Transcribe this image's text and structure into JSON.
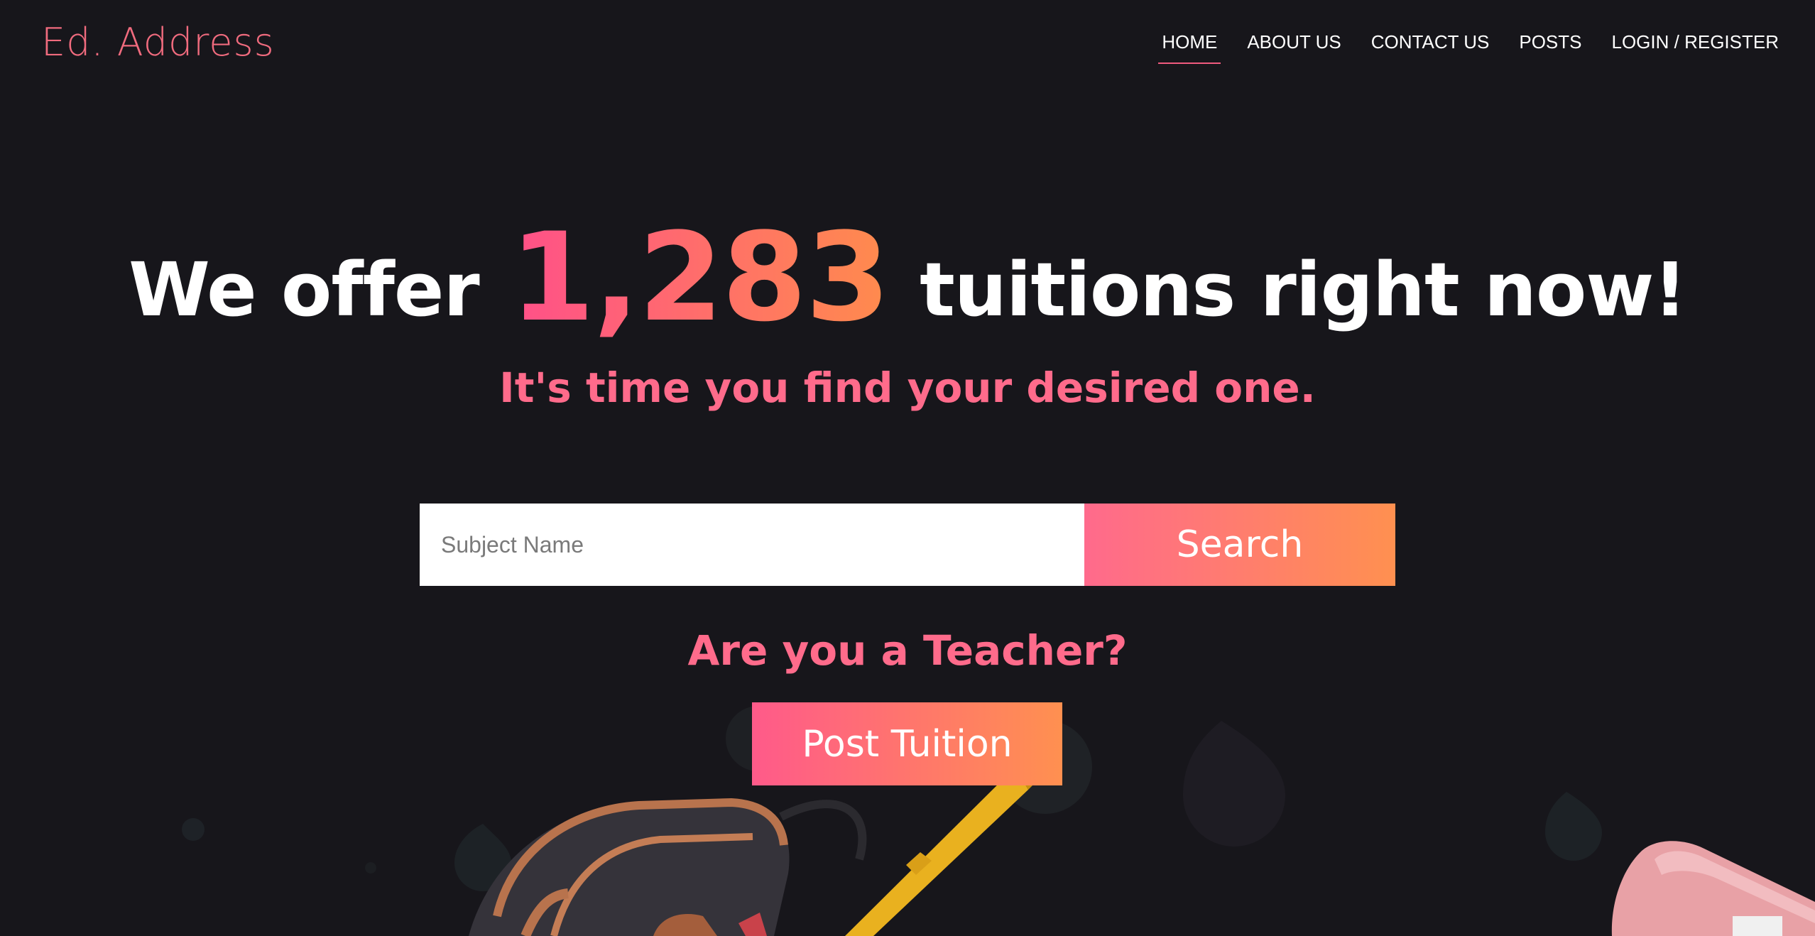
{
  "brand": {
    "logo": "Ed. Address"
  },
  "nav": {
    "items": [
      {
        "label": "HOME",
        "active": true
      },
      {
        "label": "ABOUT US",
        "active": false
      },
      {
        "label": "CONTACT US",
        "active": false
      },
      {
        "label": "POSTS",
        "active": false
      },
      {
        "label": "LOGIN / REGISTER",
        "active": false
      }
    ]
  },
  "hero": {
    "title_prefix": "We offer",
    "count": "1,283",
    "title_suffix": "tuitions right now!",
    "subtitle": "It's time you find your desired one."
  },
  "search": {
    "placeholder": "Subject Name",
    "value": "",
    "button_label": "Search"
  },
  "teacher": {
    "question": "Are you a Teacher?",
    "button_label": "Post Tuition"
  },
  "colors": {
    "background": "#17161b",
    "accent_pink": "#ff6b8b",
    "accent_orange": "#ff9050",
    "logo": "#f06b7e"
  },
  "icons": [
    "backpack-illustration",
    "pencil-illustration",
    "sharpener-illustration"
  ]
}
